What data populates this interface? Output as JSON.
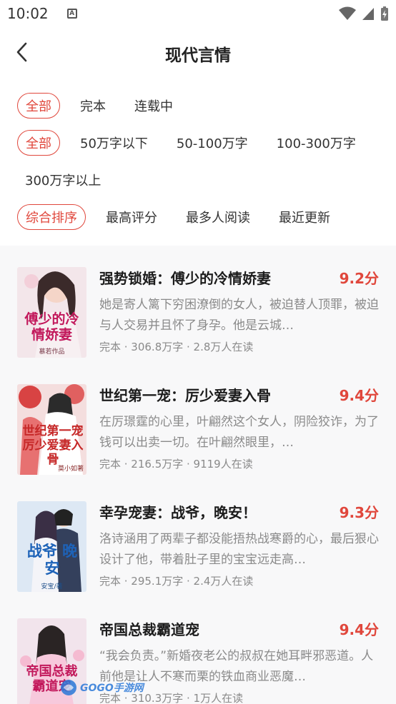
{
  "status": {
    "time": "10:02",
    "notif_letter": "A"
  },
  "header": {
    "title": "现代言情"
  },
  "filters": {
    "status": [
      {
        "label": "全部",
        "active": true
      },
      {
        "label": "完本",
        "active": false
      },
      {
        "label": "连载中",
        "active": false
      }
    ],
    "words": [
      {
        "label": "全部",
        "active": true
      },
      {
        "label": "50万字以下",
        "active": false
      },
      {
        "label": "50-100万字",
        "active": false
      },
      {
        "label": "100-300万字",
        "active": false
      },
      {
        "label": "300万字以上",
        "active": false
      }
    ],
    "sort": [
      {
        "label": "综合排序",
        "active": true
      },
      {
        "label": "最高评分",
        "active": false
      },
      {
        "label": "最多人阅读",
        "active": false
      },
      {
        "label": "最近更新",
        "active": false
      }
    ]
  },
  "books": [
    {
      "title": "强势锁婚：傅少的冷情娇妻",
      "score": "9.2分",
      "desc": "她是寄人篱下穷困潦倒的女人，被迫替人顶罪，被迫与人交易并且怀了身孕。他是云城…",
      "meta": "完本 · 306.8万字 · 2.8万人在读",
      "cover": {
        "bg": "#f3e6ea",
        "accent": "#c2185b",
        "text": "傅少的冷情娇妻",
        "author": "慕若作品"
      }
    },
    {
      "title": "世纪第一宠：厉少爱妻入骨",
      "score": "9.4分",
      "desc": "在厉璟霆的心里，叶翩然这个女人，阴险狡诈，为了钱可以出卖一切。在叶翩然眼里，…",
      "meta": "完本 · 216.5万字 · 9119人在读",
      "cover": {
        "bg": "#f4dede",
        "accent": "#c62828",
        "text": "世纪第一宠 厉少爱妻入骨",
        "author": "莫小如著"
      }
    },
    {
      "title": "幸孕宠妻：战爷，晚安！",
      "score": "9.3分",
      "desc": "洛诗涵用了两辈子都没能捂热战寒爵的心，最后狠心设计了他，带着肚子里的宝宝远走高…",
      "meta": "完本 · 295.1万字 · 2.4万人在读",
      "cover": {
        "bg": "#dde8f4",
        "accent": "#1e63b8",
        "text": "战爷 晚安",
        "author": "安宝/著"
      }
    },
    {
      "title": "帝国总裁霸道宠",
      "score": "9.4分",
      "desc": "“我会负责。”新婚夜老公的叔叔在她耳畔邪恶道。人前他是让人不寒而栗的铁血商业恶魔…",
      "meta": "完本 · 310.3万字 · 1万人在读",
      "cover": {
        "bg": "#f2e4ec",
        "accent": "#c2185b",
        "text": "帝国总裁 霸道宠",
        "author": ""
      }
    }
  ],
  "watermark": {
    "text": "GOGO手游网"
  },
  "colors": {
    "accent": "#e0473c",
    "muted": "#8a8a8a",
    "list_bg": "#f8f8f9"
  }
}
